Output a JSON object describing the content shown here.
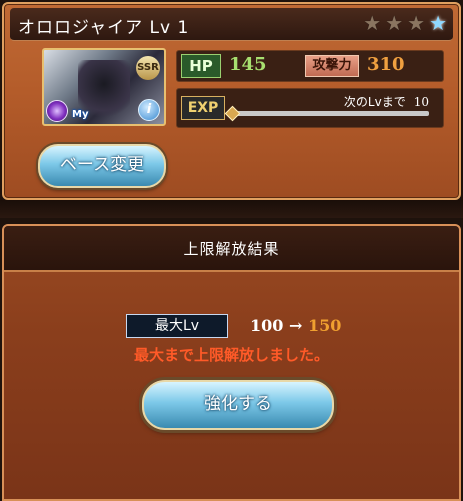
{
  "character": {
    "name": "オロロジャイア Lv 1",
    "rarity_badge": "SSR",
    "my_badge": "My",
    "info_glyph": "i",
    "stars": [
      {
        "icon": "star-icon",
        "state": "inactive",
        "glyph": "★"
      },
      {
        "icon": "star-icon",
        "state": "inactive",
        "glyph": "★"
      },
      {
        "icon": "star-icon",
        "state": "inactive",
        "glyph": "★"
      },
      {
        "icon": "star-icon",
        "state": "active",
        "glyph": "★"
      }
    ]
  },
  "stats": {
    "hp_label": "HP",
    "hp_value": "145",
    "attack_label": "攻撃力",
    "attack_value": "310",
    "exp_label": "EXP",
    "next_level_label": "次のLvまで",
    "next_level_value": "10",
    "exp_progress": 0.0
  },
  "buttons": {
    "base_change": "ベース変更",
    "enhance": "強化する"
  },
  "dialog": {
    "title": "上限解放結果",
    "max_lv_label": "最大Lv",
    "old_max": "100",
    "arrow": "→",
    "new_max": "150",
    "message": "最大まで上限解放しました。"
  },
  "colors": {
    "hp_value": "#a8e070",
    "attack_value": "#f0a040",
    "new_max": "#f0a030",
    "message": "#ff5a28",
    "star_active": "#8fd8ff",
    "star_inactive": "#8a7560"
  }
}
